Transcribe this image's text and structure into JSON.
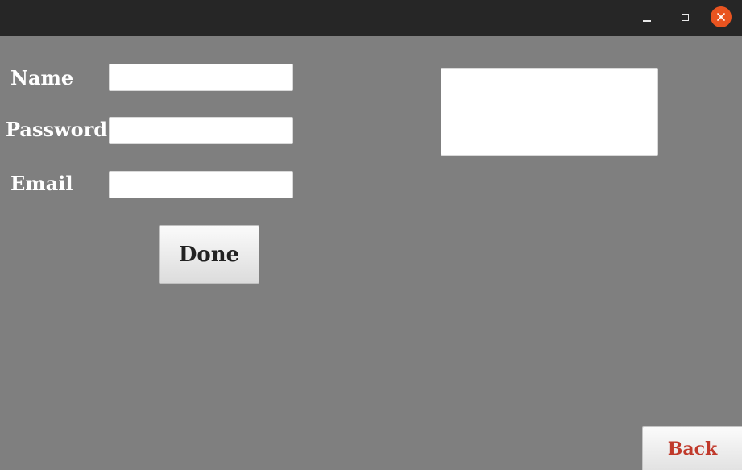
{
  "window": {
    "controls": {
      "minimize_icon": "minimize-icon",
      "maximize_icon": "maximize-icon",
      "close_icon": "close-icon",
      "close_color": "#e95420"
    }
  },
  "form": {
    "name_label": "Name",
    "name_value": "",
    "password_label": "Password",
    "password_value": "",
    "email_label": "Email",
    "email_value": "",
    "done_label": "Done"
  },
  "output": {
    "text": ""
  },
  "footer": {
    "back_label": "Back",
    "back_color": "#c0392b"
  },
  "colors": {
    "background": "#7f7f7f",
    "titlebar": "#262626"
  }
}
